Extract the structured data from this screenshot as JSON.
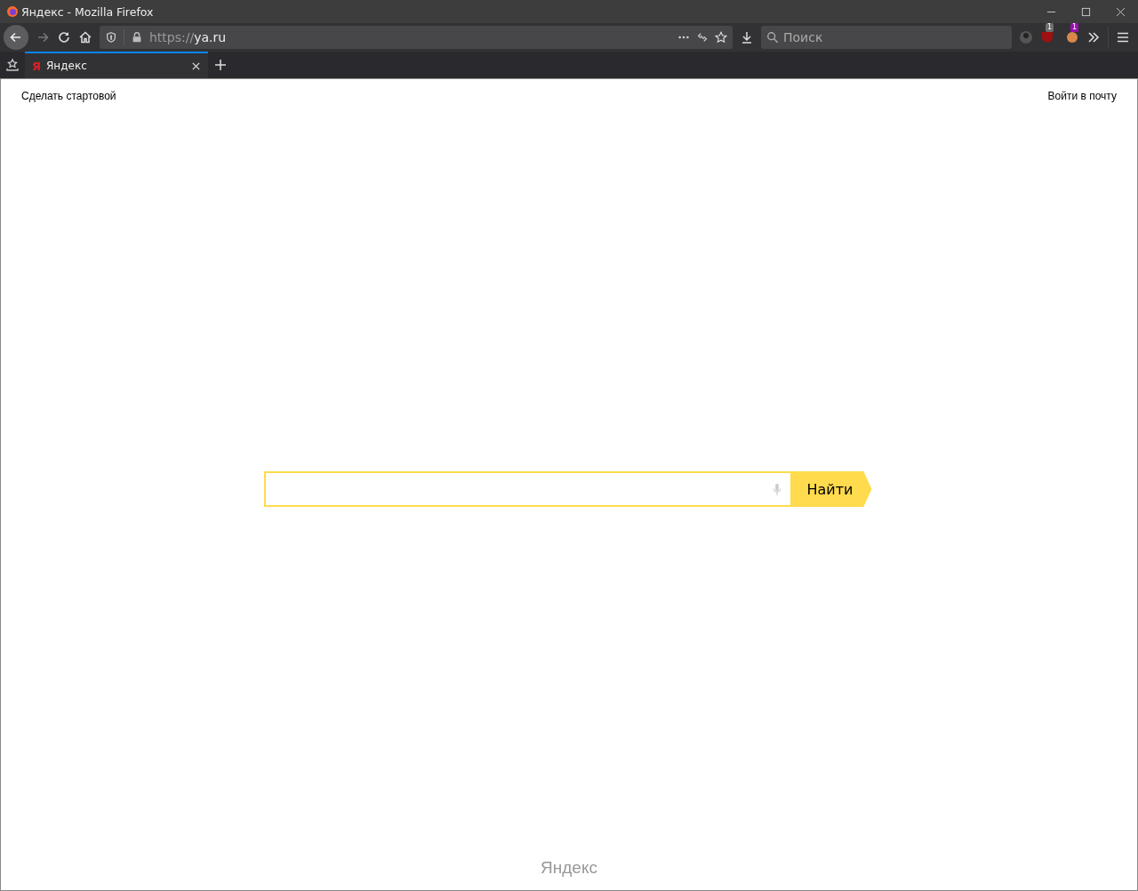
{
  "window": {
    "title": "Яндекс - Mozilla Firefox"
  },
  "toolbar": {
    "url_scheme": "https://",
    "url_host": "ya.ru",
    "search_placeholder": "Поиск",
    "extensions": [
      {
        "badge": "1",
        "color": "#6e6e6e"
      },
      {
        "badge": "1",
        "color": "#9a0fb0"
      }
    ]
  },
  "tabs": [
    {
      "favicon": "Я",
      "label": "Яндекс",
      "selected": true
    }
  ],
  "page": {
    "top_left_link": "Сделать стартовой",
    "top_right_link": "Войти в почту",
    "search_button": "Найти",
    "footer_logo": "Яндекс"
  }
}
